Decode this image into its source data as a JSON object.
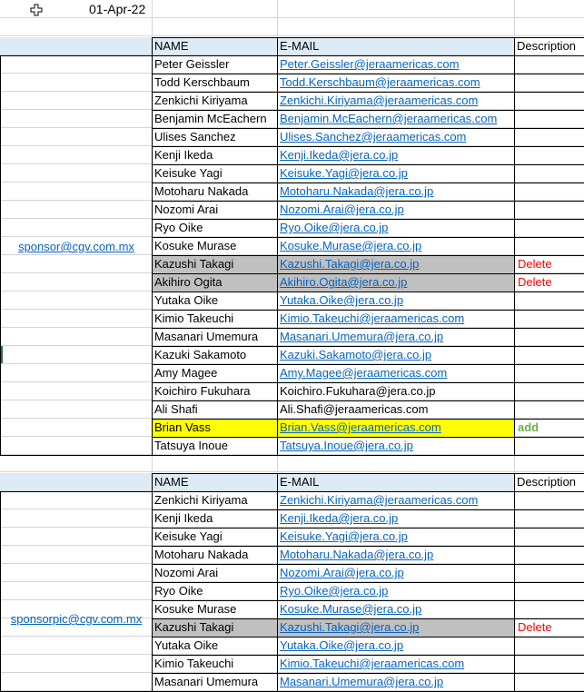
{
  "top": {
    "date": "01-Apr-22"
  },
  "table1": {
    "sponsor": "sponsor@cgv.com.mx",
    "headers": {
      "name": "NAME",
      "email": "E-MAIL",
      "description": "Description"
    },
    "rows": [
      {
        "name": "Peter Geissler",
        "email": "Peter.Geissler@jeraamericas.com",
        "desc": ""
      },
      {
        "name": "Todd Kerschbaum",
        "email": "Todd.Kerschbaum@jeraamericas.com",
        "desc": ""
      },
      {
        "name": "Zenkichi Kiriyama",
        "email": "Zenkichi.Kiriyama@jeraamericas.com",
        "desc": ""
      },
      {
        "name": "Benjamin McEachern",
        "email": "Benjamin.McEachern@jeraamericas.com",
        "desc": ""
      },
      {
        "name": "Ulises Sanchez",
        "email": "Ulises.Sanchez@jeraamericas.com",
        "desc": ""
      },
      {
        "name": "Kenji Ikeda",
        "email": "Kenji.Ikeda@jera.co.jp",
        "desc": ""
      },
      {
        "name": "Keisuke Yagi",
        "email": "Keisuke.Yagi@jera.co.jp",
        "desc": ""
      },
      {
        "name": "Motoharu Nakada",
        "email": "Motoharu.Nakada@jera.co.jp",
        "desc": ""
      },
      {
        "name": "Nozomi Arai",
        "email": "Nozomi.Arai@jera.co.jp",
        "desc": ""
      },
      {
        "name": "Ryo Oike",
        "email": "Ryo.Oike@jera.co.jp",
        "desc": ""
      },
      {
        "name": "Kosuke Murase",
        "email": "Kosuke.Murase@jera.co.jp",
        "desc": ""
      },
      {
        "name": "Kazushi Takagi",
        "email": "Kazushi.Takagi@jera.co.jp",
        "desc": "Delete"
      },
      {
        "name": "Akihiro Ogita",
        "email": "Akihiro.Ogita@jera.co.jp",
        "desc": "Delete"
      },
      {
        "name": "Yutaka Oike",
        "email": "Yutaka.Oike@jera.co.jp",
        "desc": ""
      },
      {
        "name": "Kimio Takeuchi",
        "email": "Kimio.Takeuchi@jeraamericas.com",
        "desc": ""
      },
      {
        "name": "Masanari Umemura",
        "email": "Masanari.Umemura@jera.co.jp",
        "desc": ""
      },
      {
        "name": "Kazuki Sakamoto",
        "email": "Kazuki.Sakamoto@jera.co.jp",
        "desc": ""
      },
      {
        "name": "Amy Magee",
        "email": "Amy.Magee@jeraamericas.com",
        "desc": ""
      },
      {
        "name": "Koichiro Fukuhara",
        "email": "Koichiro.Fukuhara@jera.co.jp",
        "desc": ""
      },
      {
        "name": "Ali Shafi",
        "email": "Ali.Shafi@jeraamericas.com",
        "desc": ""
      },
      {
        "name": "Brian Vass",
        "email": "Brian.Vass@jeraamericas.com",
        "desc": "add"
      },
      {
        "name": "Tatsuya Inoue",
        "email": "Tatsuya.Inoue@jera.co.jp",
        "desc": ""
      }
    ]
  },
  "table2": {
    "sponsor": "sponsorpic@cgv.com.mx",
    "headers": {
      "name": "NAME",
      "email": "E-MAIL",
      "description": "Description"
    },
    "rows": [
      {
        "name": "Zenkichi Kiriyama",
        "email": "Zenkichi.Kiriyama@jeraamericas.com",
        "desc": ""
      },
      {
        "name": "Kenji Ikeda",
        "email": "Kenji.Ikeda@jera.co.jp",
        "desc": ""
      },
      {
        "name": "Keisuke Yagi",
        "email": "Keisuke.Yagi@jera.co.jp",
        "desc": ""
      },
      {
        "name": "Motoharu Nakada",
        "email": "Motoharu.Nakada@jera.co.jp",
        "desc": ""
      },
      {
        "name": "Nozomi Arai",
        "email": "Nozomi.Arai@jera.co.jp",
        "desc": ""
      },
      {
        "name": "Ryo Oike",
        "email": "Ryo.Oike@jera.co.jp",
        "desc": ""
      },
      {
        "name": "Kosuke Murase",
        "email": "Kosuke.Murase@jera.co.jp",
        "desc": ""
      },
      {
        "name": "Kazushi Takagi",
        "email": "Kazushi.Takagi@jera.co.jp",
        "desc": "Delete"
      },
      {
        "name": "Yutaka Oike",
        "email": "Yutaka.Oike@jera.co.jp",
        "desc": ""
      },
      {
        "name": "Kimio Takeuchi",
        "email": "Kimio.Takeuchi@jeraamericas.com",
        "desc": ""
      },
      {
        "name": "Masanari Umemura",
        "email": "Masanari.Umemura@jera.co.jp",
        "desc": ""
      }
    ]
  },
  "colors": {
    "link": "#0563c1",
    "header_bg": "#ddebf7",
    "gray_bg": "#c0c0c0",
    "yellow_bg": "#ffff00",
    "delete": "#ff0000",
    "add": "#70ad47"
  },
  "icons": {
    "cursor": "cross-cursor-icon"
  }
}
